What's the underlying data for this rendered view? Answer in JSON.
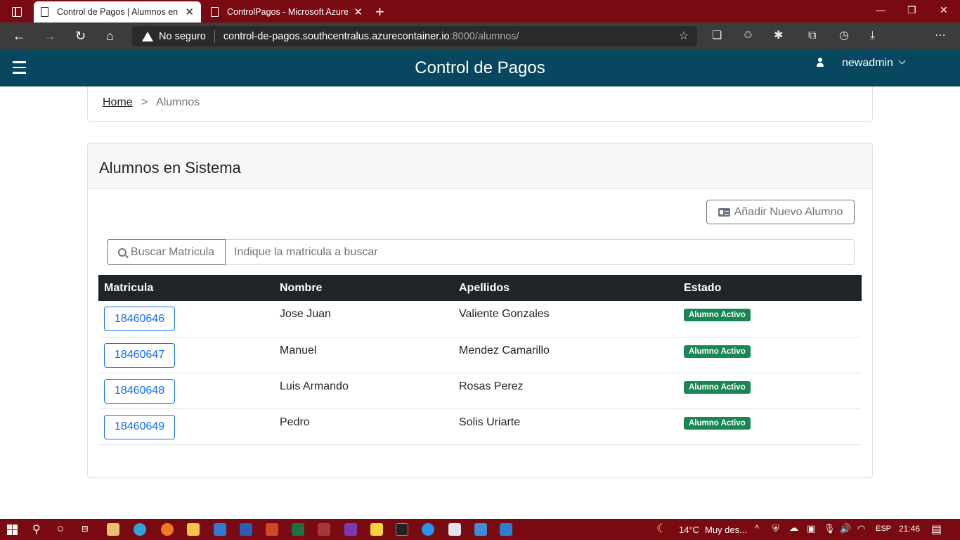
{
  "browser": {
    "tabs": [
      {
        "title": "Control de Pagos | Alumnos en S",
        "active": true
      },
      {
        "title": "ControlPagos - Microsoft Azure",
        "active": false
      }
    ],
    "security_label": "No seguro",
    "url_host": "control-de-pagos.southcentralus.azurecontainer.io",
    "url_path": ":8000/alumnos/"
  },
  "app": {
    "title": "Control de Pagos",
    "username": "newadmin"
  },
  "breadcrumb": {
    "home": "Home",
    "separator": ">",
    "current": "Alumnos"
  },
  "card": {
    "title": "Alumnos en Sistema",
    "add_button": "Añadir Nuevo Alumno",
    "search_button": "Buscar Matricula",
    "search_placeholder": "Indique la matricula a buscar"
  },
  "table": {
    "headers": [
      "Matricula",
      "Nombre",
      "Apellidos",
      "Estado"
    ],
    "rows": [
      {
        "matricula": "18460646",
        "nombre": "Jose Juan",
        "apellidos": "Valiente Gonzales",
        "estado": "Alumno Activo"
      },
      {
        "matricula": "18460647",
        "nombre": "Manuel",
        "apellidos": "Mendez Camarillo",
        "estado": "Alumno Activo"
      },
      {
        "matricula": "18460648",
        "nombre": "Luis Armando",
        "apellidos": "Rosas Perez",
        "estado": "Alumno Activo"
      },
      {
        "matricula": "18460649",
        "nombre": "Pedro",
        "apellidos": "Solis Uriarte",
        "estado": "Alumno Activo"
      }
    ]
  },
  "taskbar": {
    "temperature": "14°C",
    "weather": "Muy des...",
    "language": "ESP",
    "time": "21:46"
  },
  "colors": {
    "window_frame": "#7a0a12",
    "app_bar": "#07475f",
    "badge": "#198754",
    "link_button": "#0d6efd"
  }
}
